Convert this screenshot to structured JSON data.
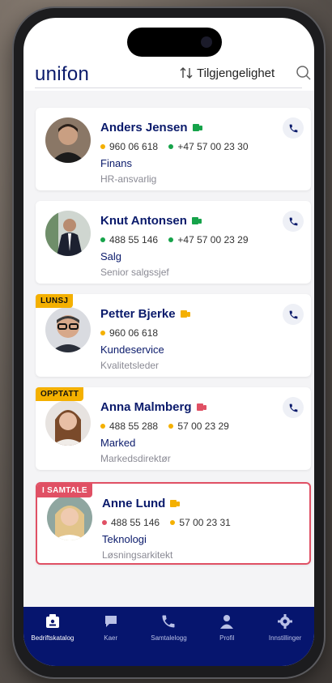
{
  "header": {
    "logo": "unifon",
    "sort_label": "Tilgjengelighet"
  },
  "contacts": [
    {
      "name": "Anders Jensen",
      "presence_color": "#16a34a",
      "mobile": "960 06 618",
      "mobile_dot": "#f4b000",
      "landline": "+47 57 00 23 30",
      "landline_dot": "#16a34a",
      "department": "Finans",
      "role": "HR-ansvarlig",
      "badge": ""
    },
    {
      "name": "Knut Antonsen",
      "presence_color": "#16a34a",
      "mobile": "488 55 146",
      "mobile_dot": "#16a34a",
      "landline": "+47 57 00 23 29",
      "landline_dot": "#16a34a",
      "department": "Salg",
      "role": "Senior salgssjef",
      "badge": ""
    },
    {
      "name": "Petter Bjerke",
      "presence_color": "#f4b000",
      "mobile": "960 06 618",
      "mobile_dot": "#f4b000",
      "landline": "",
      "landline_dot": "",
      "department": "Kundeservice",
      "role": "Kvalitetsleder",
      "badge": "LUNSJ"
    },
    {
      "name": "Anna Malmberg",
      "presence_color": "#e05064",
      "mobile": "488 55 288",
      "mobile_dot": "#f4b000",
      "landline": "57 00 23 29",
      "landline_dot": "#f4b000",
      "department": "Marked",
      "role": "Markedsdirektør",
      "badge": "OPPTATT"
    },
    {
      "name": "Anne Lund",
      "presence_color": "#f4b000",
      "mobile": "488 55 146",
      "mobile_dot": "#e05064",
      "landline": "57 00 23 31",
      "landline_dot": "#f4b000",
      "department": "Teknologi",
      "role": "Løsningsarkitekt",
      "badge": "I SAMTALE"
    }
  ],
  "tabs": [
    {
      "label": "Bedriftskatalog",
      "icon": "directory-icon",
      "active": true
    },
    {
      "label": "Kaer",
      "icon": "chat-icon",
      "active": false
    },
    {
      "label": "Samtalelogg",
      "icon": "phone-icon",
      "active": false
    },
    {
      "label": "Profil",
      "icon": "person-icon",
      "active": false
    },
    {
      "label": "Innstillinger",
      "icon": "gear-icon",
      "active": false
    }
  ],
  "colors": {
    "brand_navy": "#0a1a6b",
    "tabbar": "#06156e",
    "available": "#16a34a",
    "away": "#f4b000",
    "busy": "#e05064"
  }
}
